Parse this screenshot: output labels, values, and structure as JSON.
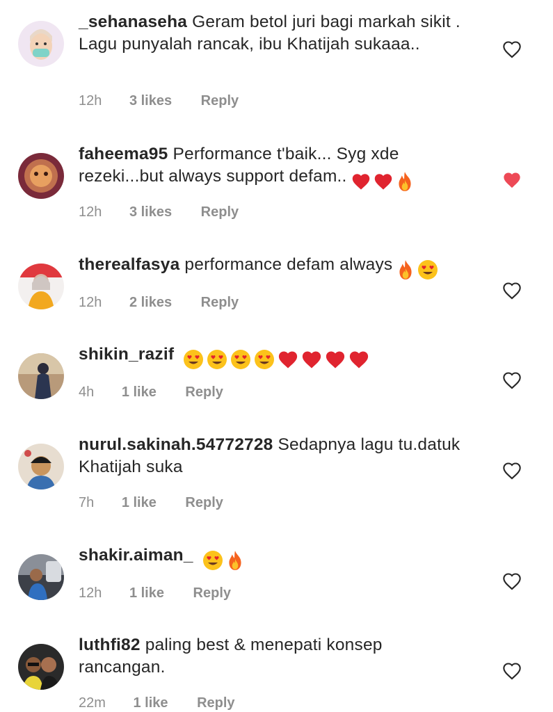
{
  "colors": {
    "text": "#262626",
    "meta": "#8e8e8e",
    "liked": "#ed4956"
  },
  "comments": [
    {
      "username": "_sehanaseha",
      "text": "Geram betol juri bagi markah sikit . Lagu punyalah rancak, ibu Khatijah sukaaa..",
      "emojis": [],
      "time": "12h",
      "likes": "3 likes",
      "reply": "Reply",
      "liked": false
    },
    {
      "username": "faheema95",
      "text": "Performance t'baik... Syg xde rezeki...but always support defam..",
      "emojis": [
        "red-heart-emoji",
        "red-heart-emoji",
        "fire-emoji"
      ],
      "time": "12h",
      "likes": "3 likes",
      "reply": "Reply",
      "liked": true
    },
    {
      "username": "therealfasya",
      "text": "performance defam always",
      "emojis": [
        "fire-emoji",
        "heart-eyes-emoji"
      ],
      "time": "12h",
      "likes": "2 likes",
      "reply": "Reply",
      "liked": false
    },
    {
      "username": "shikin_razif",
      "text": "",
      "emojis": [
        "heart-eyes-emoji",
        "heart-eyes-emoji",
        "heart-eyes-emoji",
        "heart-eyes-emoji",
        "red-heart-emoji",
        "red-heart-emoji",
        "red-heart-emoji",
        "red-heart-emoji"
      ],
      "time": "4h",
      "likes": "1 like",
      "reply": "Reply",
      "liked": false
    },
    {
      "username": "nurul.sakinah.54772728",
      "text": "Sedapnya lagu tu.datuk Khatijah suka",
      "emojis": [],
      "time": "7h",
      "likes": "1 like",
      "reply": "Reply",
      "liked": false
    },
    {
      "username": "shakir.aiman_",
      "text": "",
      "emojis": [
        "heart-eyes-emoji",
        "fire-emoji"
      ],
      "time": "12h",
      "likes": "1 like",
      "reply": "Reply",
      "liked": false
    },
    {
      "username": "luthfi82",
      "text": "paling best & menepati konsep rancangan.",
      "emojis": [],
      "time": "22m",
      "likes": "1 like",
      "reply": "Reply",
      "liked": false
    }
  ]
}
